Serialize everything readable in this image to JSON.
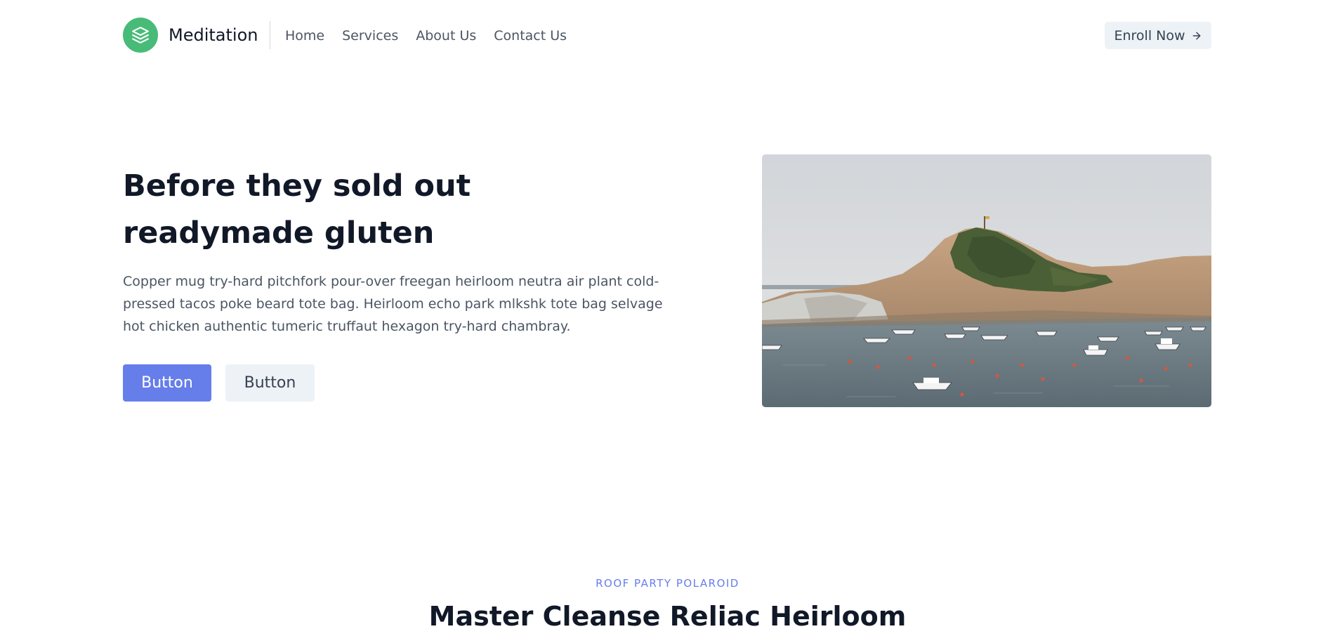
{
  "header": {
    "brand_name": "Meditation",
    "logo_icon": "layers-icon",
    "nav": [
      {
        "label": "Home"
      },
      {
        "label": "Services"
      },
      {
        "label": "About Us"
      },
      {
        "label": "Contact Us"
      }
    ],
    "cta_label": "Enroll Now",
    "cta_icon": "arrow-right-icon"
  },
  "hero": {
    "title_line1": "Before they sold out",
    "title_line2": "readymade gluten",
    "description": "Copper mug try-hard pitchfork pour-over freegan heirloom neutra air plant cold-pressed tacos poke beard tote bag. Heirloom echo park mlkshk tote bag selvage hot chicken authentic tumeric truffaut hexagon try-hard chambray.",
    "primary_button": "Button",
    "secondary_button": "Button"
  },
  "section": {
    "eyebrow": "ROOF PARTY POLAROID",
    "title": "Master Cleanse Reliac Heirloom"
  },
  "colors": {
    "brand_green": "#48bb78",
    "accent_indigo": "#667eea",
    "light_gray_button": "#edf2f7",
    "text_dark": "#111827",
    "text_muted": "#4b5563"
  }
}
